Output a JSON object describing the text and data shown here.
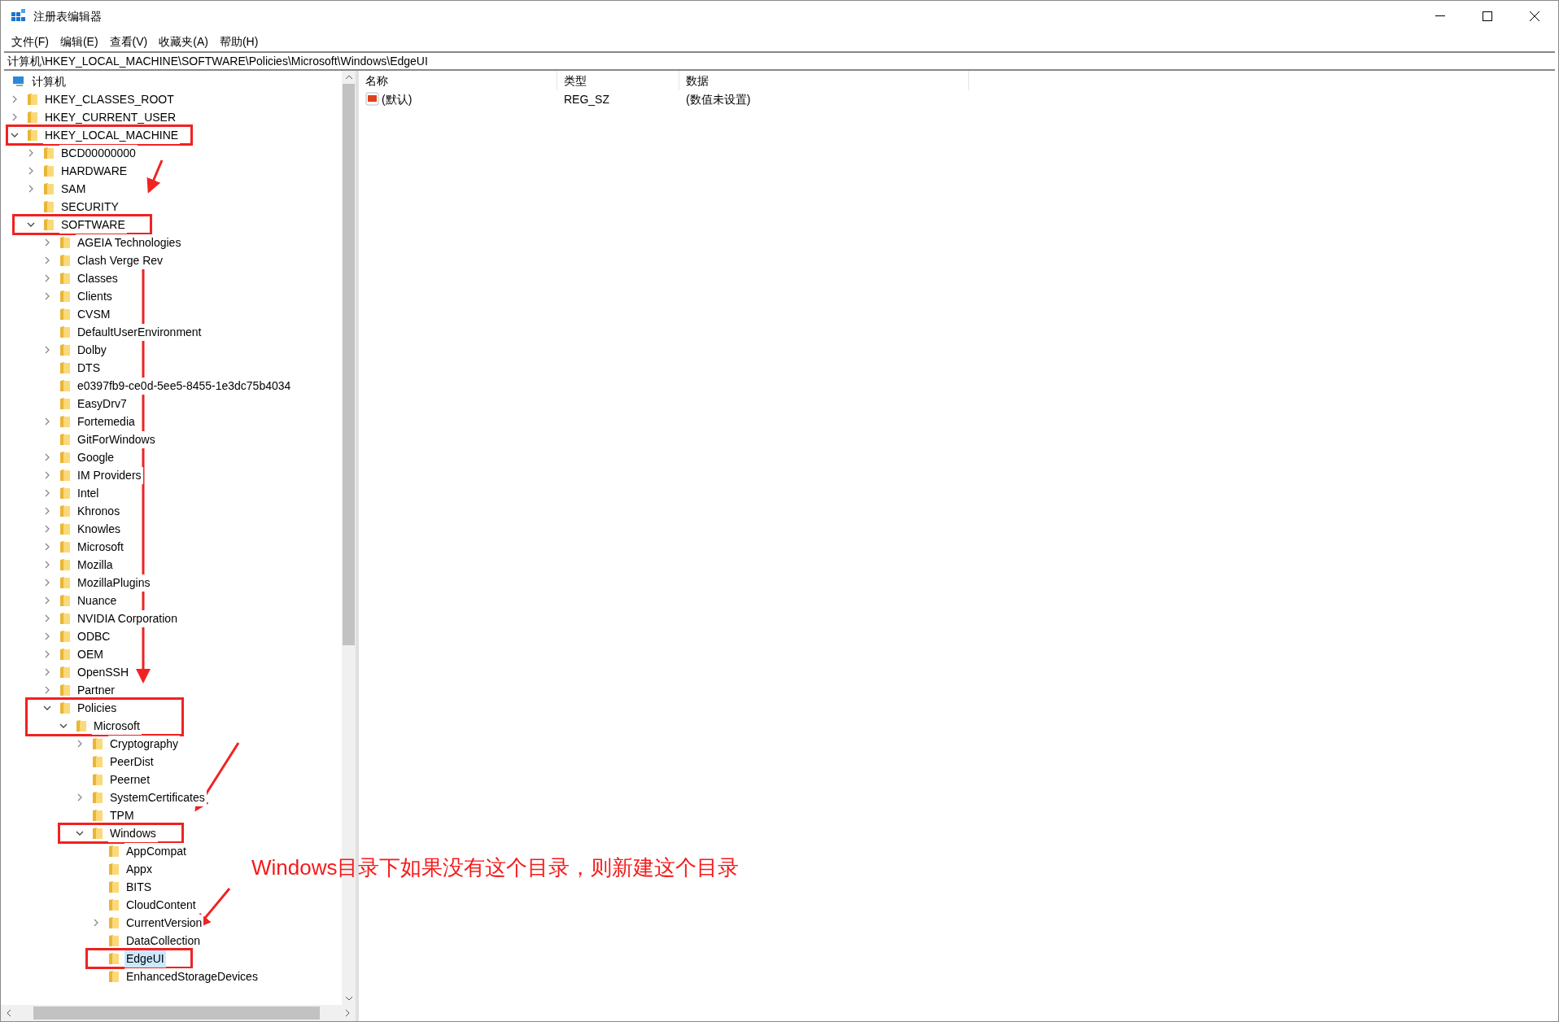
{
  "window": {
    "title": "注册表编辑器"
  },
  "menu": [
    "文件(F)",
    "编辑(E)",
    "查看(V)",
    "收藏夹(A)",
    "帮助(H)"
  ],
  "address": "计算机\\HKEY_LOCAL_MACHINE\\SOFTWARE\\Policies\\Microsoft\\Windows\\EdgeUI",
  "tree": [
    {
      "label": "计算机",
      "kind": "computer",
      "selected": false,
      "children": [
        {
          "label": "HKEY_CLASSES_ROOT",
          "expanded": false,
          "selected": false
        },
        {
          "label": "HKEY_CURRENT_USER",
          "expanded": false,
          "selected": false
        },
        {
          "label": "HKEY_LOCAL_MACHINE",
          "expanded": true,
          "boxed": true,
          "selected": false,
          "children": [
            {
              "label": "BCD00000000",
              "expanded": false,
              "selected": false
            },
            {
              "label": "HARDWARE",
              "expanded": false,
              "selected": false
            },
            {
              "label": "SAM",
              "expanded": false,
              "selected": false
            },
            {
              "label": "SECURITY",
              "selected": false
            },
            {
              "label": "SOFTWARE",
              "expanded": true,
              "boxed": true,
              "selected": false,
              "children": [
                {
                  "label": "AGEIA Technologies",
                  "expanded": false,
                  "selected": false
                },
                {
                  "label": "Clash Verge Rev",
                  "expanded": false,
                  "selected": false
                },
                {
                  "label": "Classes",
                  "expanded": false,
                  "selected": false
                },
                {
                  "label": "Clients",
                  "expanded": false,
                  "selected": false
                },
                {
                  "label": "CVSM",
                  "selected": false
                },
                {
                  "label": "DefaultUserEnvironment",
                  "selected": false
                },
                {
                  "label": "Dolby",
                  "expanded": false,
                  "selected": false
                },
                {
                  "label": "DTS",
                  "selected": false
                },
                {
                  "label": "e0397fb9-ce0d-5ee5-8455-1e3dc75b4034",
                  "selected": false
                },
                {
                  "label": "EasyDrv7",
                  "selected": false
                },
                {
                  "label": "Fortemedia",
                  "expanded": false,
                  "selected": false
                },
                {
                  "label": "GitForWindows",
                  "selected": false
                },
                {
                  "label": "Google",
                  "expanded": false,
                  "selected": false
                },
                {
                  "label": "IM Providers",
                  "expanded": false,
                  "selected": false
                },
                {
                  "label": "Intel",
                  "expanded": false,
                  "selected": false
                },
                {
                  "label": "Khronos",
                  "expanded": false,
                  "selected": false
                },
                {
                  "label": "Knowles",
                  "expanded": false,
                  "selected": false
                },
                {
                  "label": "Microsoft",
                  "expanded": false,
                  "selected": false
                },
                {
                  "label": "Mozilla",
                  "expanded": false,
                  "selected": false
                },
                {
                  "label": "MozillaPlugins",
                  "expanded": false,
                  "selected": false
                },
                {
                  "label": "Nuance",
                  "expanded": false,
                  "selected": false
                },
                {
                  "label": "NVIDIA Corporation",
                  "expanded": false,
                  "selected": false
                },
                {
                  "label": "ODBC",
                  "expanded": false,
                  "selected": false
                },
                {
                  "label": "OEM",
                  "expanded": false,
                  "selected": false
                },
                {
                  "label": "OpenSSH",
                  "expanded": false,
                  "selected": false
                },
                {
                  "label": "Partner",
                  "expanded": false,
                  "selected": false
                },
                {
                  "label": "Policies",
                  "expanded": true,
                  "boxed": true,
                  "selected": false,
                  "children": [
                    {
                      "label": "Microsoft",
                      "expanded": true,
                      "boxed": true,
                      "selected": false,
                      "children": [
                        {
                          "label": "Cryptography",
                          "expanded": false,
                          "selected": false
                        },
                        {
                          "label": "PeerDist",
                          "selected": false
                        },
                        {
                          "label": "Peernet",
                          "selected": false
                        },
                        {
                          "label": "SystemCertificates",
                          "expanded": false,
                          "selected": false
                        },
                        {
                          "label": "TPM",
                          "selected": false
                        },
                        {
                          "label": "Windows",
                          "expanded": true,
                          "boxed": true,
                          "selected": false,
                          "children": [
                            {
                              "label": "AppCompat",
                              "selected": false
                            },
                            {
                              "label": "Appx",
                              "selected": false
                            },
                            {
                              "label": "BITS",
                              "selected": false
                            },
                            {
                              "label": "CloudContent",
                              "selected": false
                            },
                            {
                              "label": "CurrentVersion",
                              "expanded": false,
                              "selected": false
                            },
                            {
                              "label": "DataCollection",
                              "selected": false
                            },
                            {
                              "label": "EdgeUI",
                              "boxed": true,
                              "selected": true
                            },
                            {
                              "label": "EnhancedStorageDevices",
                              "selected": false
                            }
                          ]
                        }
                      ]
                    }
                  ]
                }
              ]
            }
          ]
        }
      ]
    }
  ],
  "values": {
    "columns": [
      "名称",
      "类型",
      "数据"
    ],
    "rows": [
      {
        "name": "(默认)",
        "type": "REG_SZ",
        "data": "(数值未设置)"
      }
    ]
  },
  "annotation": "Windows目录下如果没有这个目录，则新建这个目录"
}
